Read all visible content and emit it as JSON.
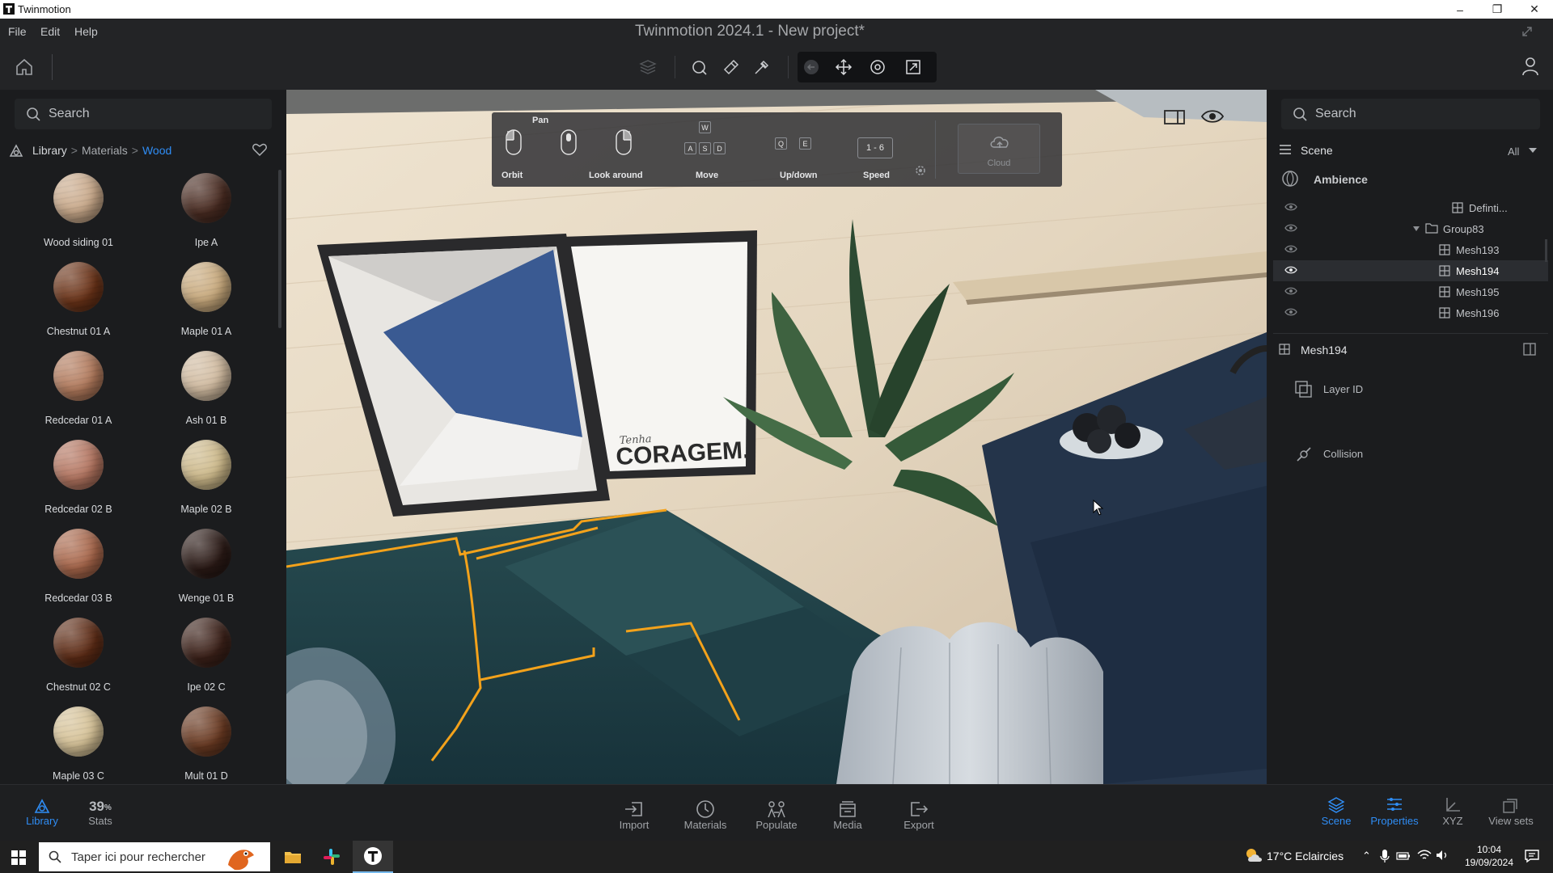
{
  "window": {
    "title": "Twinmotion",
    "minimize": "–",
    "restore": "❐",
    "close": "✕"
  },
  "menu": {
    "file": "File",
    "edit": "Edit",
    "help": "Help",
    "app_title": "Twinmotion 2024.1 - New project*"
  },
  "left": {
    "search_placeholder": "Search",
    "breadcrumb": {
      "library": "Library",
      "sep": ">",
      "materials": "Materials",
      "wood": "Wood"
    },
    "materials": [
      {
        "label": "Wood siding 01",
        "color": "#c9a98a"
      },
      {
        "label": "Ipe A",
        "color": "#4a2c22"
      },
      {
        "label": "Chestnut 01 A",
        "color": "#6b3318"
      },
      {
        "label": "Maple 01 A",
        "color": "#c8a97c"
      },
      {
        "label": "Redcedar 01 A",
        "color": "#b27a5c"
      },
      {
        "label": "Ash 01 B",
        "color": "#d1bba0"
      },
      {
        "label": "Redcedar 02 B",
        "color": "#b47560"
      },
      {
        "label": "Maple 02 B",
        "color": "#cdb98a"
      },
      {
        "label": "Redcedar 03 B",
        "color": "#a9674b"
      },
      {
        "label": "Wenge 01 B",
        "color": "#2b1a16"
      },
      {
        "label": "Chestnut 02 C",
        "color": "#5e2c16"
      },
      {
        "label": "Ipe 02 C",
        "color": "#3c2119"
      },
      {
        "label": "Maple 03 C",
        "color": "#d6c297"
      },
      {
        "label": "Mult 01 D",
        "color": "#6a3a22"
      }
    ]
  },
  "hud": {
    "pan": "Pan",
    "orbit": "Orbit",
    "look_around": "Look around",
    "move": "Move",
    "updown": "Up/down",
    "speed": "Speed",
    "speed_value": "1 - 6",
    "cloud": "Cloud",
    "keys": {
      "w": "W",
      "a": "A",
      "s": "S",
      "d": "D",
      "q": "Q",
      "e": "E"
    }
  },
  "poster": {
    "small": "Tenha",
    "word": "CORAGEM."
  },
  "right": {
    "search_placeholder": "Search",
    "scene_label": "Scene",
    "filter": "All",
    "ambience": "Ambience",
    "tree": [
      {
        "label": "Definti...",
        "selected": false
      },
      {
        "label": "Group83",
        "selected": false
      },
      {
        "label": "Mesh193",
        "selected": false
      },
      {
        "label": "Mesh194",
        "selected": true
      },
      {
        "label": "Mesh195",
        "selected": false
      },
      {
        "label": "Mesh196",
        "selected": false
      }
    ],
    "selected_name": "Mesh194",
    "layer_id": "Layer ID",
    "collision": "Collision"
  },
  "bottom": {
    "library": "Library",
    "stats_value": "39",
    "stats_unit": "%",
    "stats": "Stats",
    "import": "Import",
    "materials": "Materials",
    "populate": "Populate",
    "media": "Media",
    "export": "Export",
    "scene": "Scene",
    "properties": "Properties",
    "xyz": "XYZ",
    "viewsets": "View sets"
  },
  "taskbar": {
    "search": "Taper ici pour rechercher",
    "weather": "17°C Eclaircies",
    "time": "10:04",
    "date": "19/09/2024"
  },
  "colors": {
    "accent": "#2f8df5",
    "selection_outline": "#f3a21b",
    "sofa": "#1f3d42"
  }
}
